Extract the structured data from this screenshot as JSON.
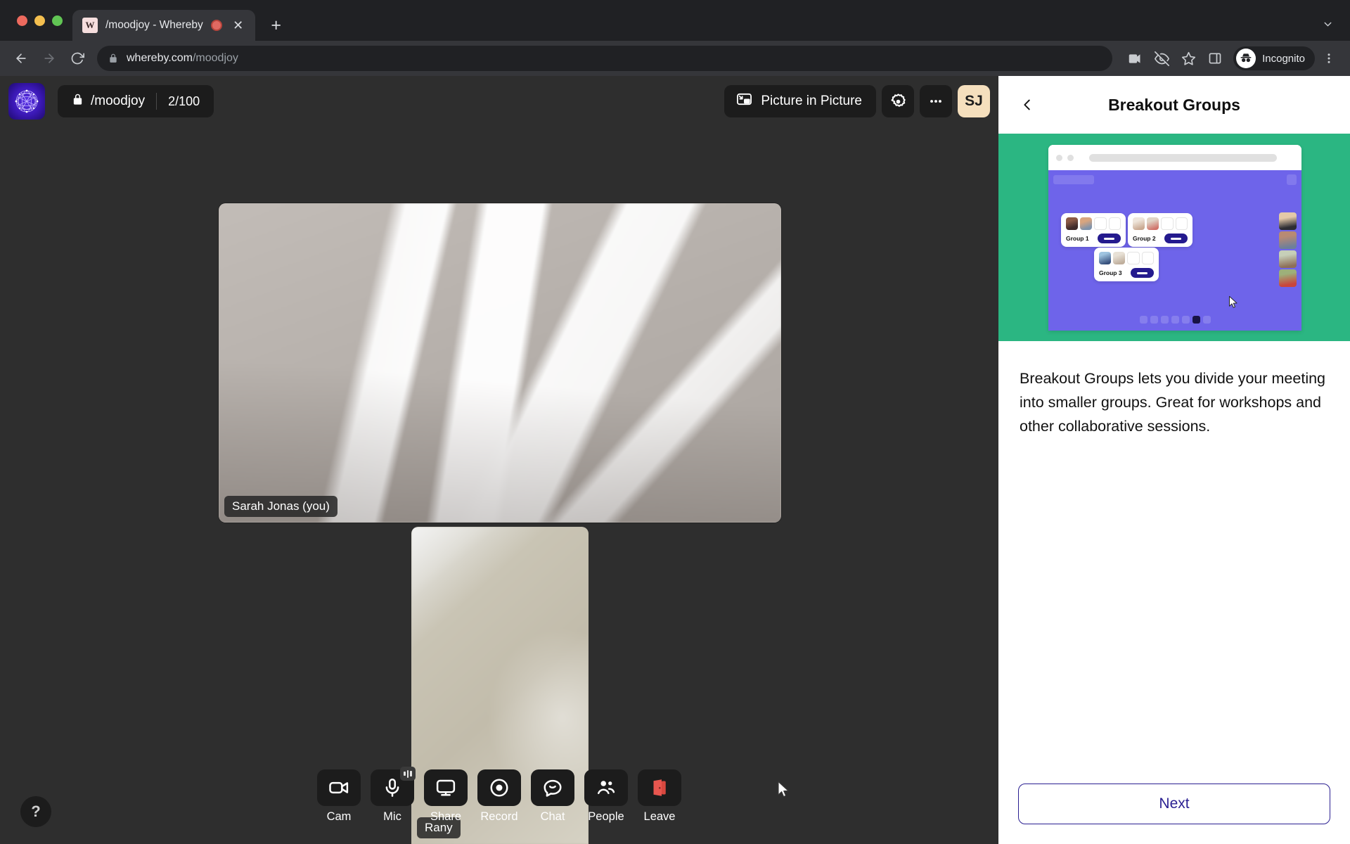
{
  "browser": {
    "tab": {
      "favicon_letter": "W",
      "title": "/moodjoy - Whereby",
      "recording_indicator": "recording-dot",
      "close_icon": "close-icon"
    },
    "new_tab_label": "+",
    "tab_list_icon": "chevron-down-icon",
    "nav": {
      "back_icon": "back-arrow-icon",
      "forward_icon": "forward-arrow-icon",
      "reload_icon": "reload-icon"
    },
    "omnibox": {
      "lock_icon": "lock-icon",
      "domain": "whereby.com",
      "path": "/moodjoy",
      "full_url": "whereby.com/moodjoy"
    },
    "toolbar_icons": [
      "video-camera-icon",
      "eye-off-icon",
      "star-icon",
      "side-panel-icon"
    ],
    "profile": {
      "label": "Incognito",
      "icon": "incognito-icon"
    },
    "menu_icon": "three-dot-menu-icon"
  },
  "app": {
    "header": {
      "logo": "whereby-room-logo",
      "lock_icon": "lock-icon",
      "room_name": "/moodjoy",
      "participant_count": "2/100",
      "pip_label": "Picture in Picture",
      "pip_icon": "picture-in-picture-icon",
      "settings_icon": "gear-icon",
      "more_icon": "three-dot-menu-icon",
      "avatar_initials": "SJ",
      "avatar_color": "#f5dfbd"
    },
    "videos": [
      {
        "name": "Sarah Jonas (you)",
        "role": "main"
      },
      {
        "name": "Rany",
        "role": "pip"
      }
    ],
    "controls": [
      {
        "label": "Cam",
        "icon": "camera-icon"
      },
      {
        "label": "Mic",
        "icon": "microphone-icon",
        "badge": "audio-level-icon"
      },
      {
        "label": "Share",
        "icon": "screen-share-icon"
      },
      {
        "label": "Record",
        "icon": "record-icon"
      },
      {
        "label": "Chat",
        "icon": "chat-bubble-icon"
      },
      {
        "label": "People",
        "icon": "people-icon"
      },
      {
        "label": "Leave",
        "icon": "leave-door-icon",
        "color": "#e8564f"
      }
    ],
    "help_label": "?"
  },
  "panel": {
    "back_icon": "chevron-left-icon",
    "title": "Breakout Groups",
    "illustration": {
      "background_color": "#2bb682",
      "app_color": "#6e64ea",
      "groups": [
        "Group 1",
        "Group 2",
        "Group 3"
      ],
      "side_participants": 4,
      "pager_dots": 7,
      "active_pager_index": 5,
      "cursor": "mouse-cursor-icon"
    },
    "description": "Breakout Groups lets you divide your meeting into smaller groups. Great for workshops and other collaborative sessions.",
    "next_label": "Next",
    "next_color": "#2a1f91"
  }
}
